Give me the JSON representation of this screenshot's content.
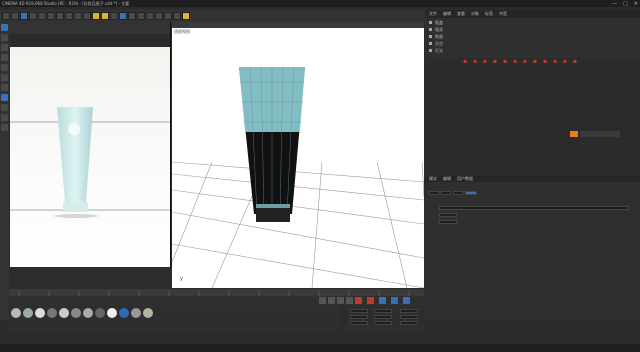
{
  "app": {
    "title": "CINEMA 4D R19.068 Studio (RC - R19) - [化妆品瓶子.c4d *] - 主要",
    "minimize": "—",
    "maximize": "□",
    "close": "✕"
  },
  "viewport": {
    "label": "透视视图",
    "axis_label": "y"
  },
  "object_manager": {
    "tabs": [
      "文件",
      "编辑",
      "查看",
      "对象",
      "标签",
      "书签"
    ],
    "objects": [
      "瓶盖",
      "瓶身",
      "地面",
      "天空",
      "灯光"
    ]
  },
  "attribute_manager": {
    "tabs": [
      "模式",
      "编辑",
      "用户数据"
    ]
  },
  "colors": {
    "accent": "#3b6fb4",
    "highlight": "#e1b22c",
    "bottle_top": "#8fd0d8",
    "bottle_body": "#111111"
  }
}
